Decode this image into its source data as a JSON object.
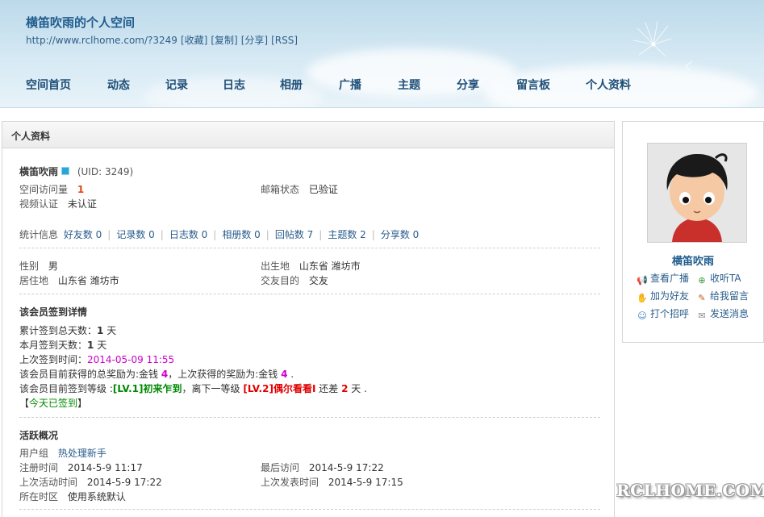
{
  "header": {
    "site_title": "横笛吹雨的个人空间",
    "url": "http://www.rclhome.com/?3249",
    "links": [
      "[收藏]",
      "[复制]",
      "[分享]",
      "[RSS]"
    ]
  },
  "nav": [
    "空间首页",
    "动态",
    "记录",
    "日志",
    "相册",
    "广播",
    "主题",
    "分享",
    "留言板",
    "个人资料"
  ],
  "main": {
    "section_title": "个人资料",
    "username": "横笛吹雨",
    "uid": "(UID: 3249)",
    "visits_label": "空间访问量",
    "visits_value": "1",
    "email_label": "邮箱状态",
    "email_value": "已验证",
    "video_label": "视频认证",
    "video_value": "未认证",
    "stats_label": "统计信息",
    "stats": [
      "好友数 0",
      "记录数 0",
      "日志数 0",
      "相册数 0",
      "回帖数 7",
      "主题数 2",
      "分享数 0"
    ],
    "gender_label": "性别",
    "gender_value": "男",
    "birthplace_label": "出生地",
    "birthplace_value": "山东省 潍坊市",
    "residence_label": "居住地",
    "residence_value": "山东省 潍坊市",
    "purpose_label": "交友目的",
    "purpose_value": "交友",
    "checkin": {
      "title": "该会员签到详情",
      "total_label": "累计签到总天数：",
      "total_value": "1",
      "total_unit": "天",
      "month_label": "本月签到天数：",
      "month_value": "1",
      "month_unit": "天",
      "last_label": "上次签到时间：",
      "last_value": "2014-05-09 11:55",
      "reward_text1": "该会员目前获得的总奖励为:金钱",
      "reward_total": "4",
      "reward_text2": "，上次获得的奖励为:金钱",
      "reward_last": "4",
      "reward_text3": ".",
      "level_text1": "该会员目前签到等级 :",
      "level_current": "[LV.1]初来乍到",
      "level_text2": "，离下一等级",
      "level_next": "[LV.2]偶尔看看I",
      "level_text3": "还差",
      "level_diff": "2",
      "level_text4": "天 .",
      "today_open": "【",
      "today_status": "今天已签到",
      "today_close": "】"
    },
    "activity": {
      "title": "活跃概况",
      "group_label": "用户组",
      "group_value": "热处理新手",
      "reg_label": "注册时间",
      "reg_value": "2014-5-9 11:17",
      "last_visit_label": "最后访问",
      "last_visit_value": "2014-5-9 17:22",
      "last_active_label": "上次活动时间",
      "last_active_value": "2014-5-9 17:22",
      "last_post_label": "上次发表时间",
      "last_post_value": "2014-5-9 17:15",
      "timezone_label": "所在时区",
      "timezone_value": "使用系统默认"
    }
  },
  "sidebar": {
    "name": "横笛吹雨",
    "actions": [
      "查看广播",
      "收听TA",
      "加为好友",
      "给我留言",
      "打个招呼",
      "发送消息"
    ]
  },
  "watermark": "RCLHOME.COM",
  "colors": {
    "link": "#2b5d8c",
    "nav": "#1f4f78",
    "highlight": "#cc00cc",
    "level_current": "#008800",
    "level_next": "#e00000"
  }
}
